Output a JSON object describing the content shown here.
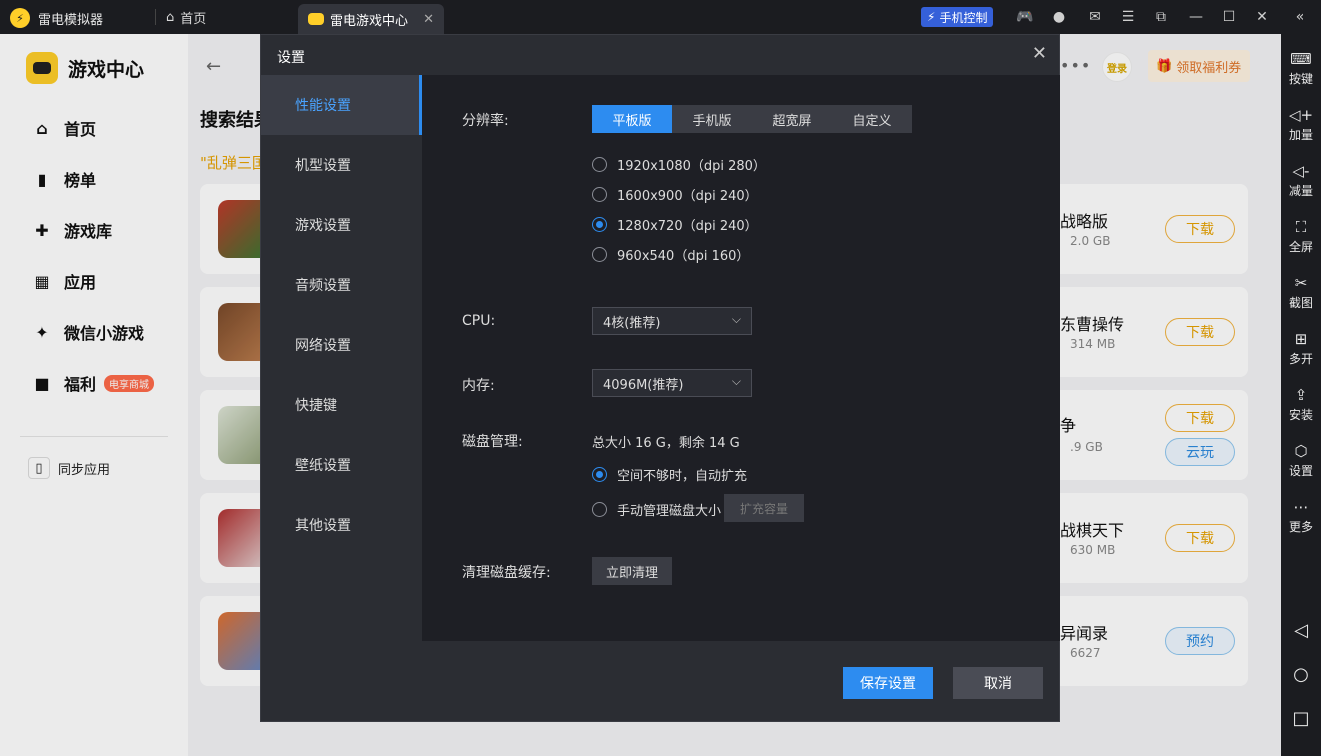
{
  "titlebar": {
    "app_name": "雷电模拟器",
    "home_tab": "首页",
    "active_tab": "雷电游戏中心",
    "phone_control": "手机控制"
  },
  "leftnav": {
    "brand": "游戏中心",
    "items": [
      {
        "label": "首页",
        "icon": "home-icon"
      },
      {
        "label": "榜单",
        "icon": "chart-icon"
      },
      {
        "label": "游戏库",
        "icon": "gamepad-icon"
      },
      {
        "label": "应用",
        "icon": "apps-icon"
      },
      {
        "label": "微信小游戏",
        "icon": "wechat-game-icon"
      },
      {
        "label": "福利",
        "icon": "gift-icon",
        "badge": "电享商城"
      }
    ],
    "sync": "同步应用"
  },
  "main": {
    "login": "登录",
    "coupon": "领取福利券",
    "search_title": "搜索结果",
    "search_query": "\"乱弹三国",
    "cards": [
      {
        "name": "战略版",
        "size": "2.0 GB",
        "buttons": [
          "下载"
        ]
      },
      {
        "name": "东曹操传",
        "size": "314 MB",
        "buttons": [
          "下载"
        ]
      },
      {
        "name": "争",
        "size": ".9 GB",
        "buttons": [
          "下载",
          "云玩"
        ]
      },
      {
        "name": "战棋天下",
        "size": "630 MB",
        "buttons": [
          "下载"
        ]
      },
      {
        "name": "异闻录",
        "size": "6627",
        "buttons": [
          "预约"
        ]
      }
    ]
  },
  "rightbar": {
    "items": [
      "按键",
      "加量",
      "减量",
      "全屏",
      "截图",
      "多开",
      "安装",
      "设置",
      "更多"
    ]
  },
  "dialog": {
    "title": "设置",
    "sidebar": [
      "性能设置",
      "机型设置",
      "游戏设置",
      "音频设置",
      "网络设置",
      "快捷键",
      "壁纸设置",
      "其他设置"
    ],
    "resolution_label": "分辨率:",
    "resolution_tabs": [
      "平板版",
      "手机版",
      "超宽屏",
      "自定义"
    ],
    "resolution_options": [
      "1920x1080（dpi 280）",
      "1600x900（dpi 240）",
      "1280x720（dpi 240）",
      "960x540（dpi 160）"
    ],
    "selected_resolution": 2,
    "cpu_label": "CPU:",
    "cpu_value": "4核(推荐)",
    "memory_label": "内存:",
    "memory_value": "4096M(推荐)",
    "disk_label": "磁盘管理:",
    "disk_info": "总大小 16 G，剩余 14 G",
    "disk_option_auto": "空间不够时，自动扩充",
    "disk_option_manual": "手动管理磁盘大小",
    "expand_button": "扩充容量",
    "clear_label": "清理磁盘缓存:",
    "clear_button": "立即清理",
    "save_button": "保存设置",
    "cancel_button": "取消"
  },
  "colors": {
    "accent": "#2d8cf0",
    "brand_yellow": "#ffcf29",
    "dialog_bg": "#1e1f25"
  }
}
